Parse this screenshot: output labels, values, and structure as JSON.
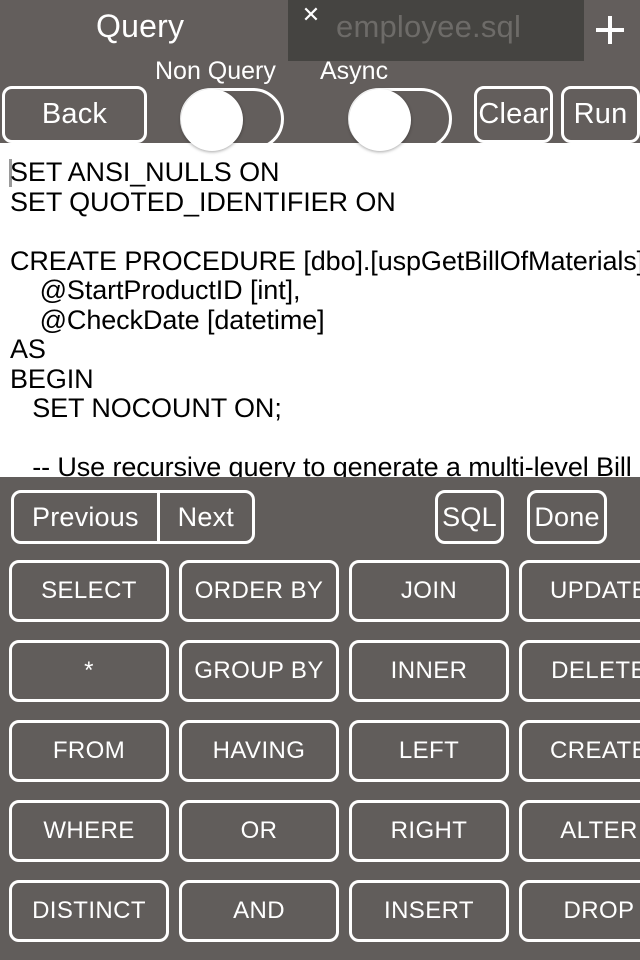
{
  "header": {
    "title": "Query",
    "add_tab_icon": "plus-icon",
    "tab": {
      "label": "employee.sql",
      "close_icon": "close-icon"
    },
    "switches": [
      {
        "label": "Non Query",
        "state": "off"
      },
      {
        "label": "Async",
        "state": "off"
      }
    ],
    "buttons": {
      "back": "Back",
      "clear": "Clear",
      "run": "Run"
    },
    "colors": {
      "bar": "#635E5C",
      "tab": "#454441",
      "tab_text": "#6D6B68",
      "text": "#FFFFFF"
    }
  },
  "editor": {
    "caret_visible": true,
    "lines": [
      "SET ANSI_NULLS ON",
      "SET QUOTED_IDENTIFIER ON",
      "",
      "CREATE PROCEDURE [dbo].[uspGetBillOfMaterials]",
      "    @StartProductID [int],",
      "    @CheckDate [datetime]",
      "AS",
      "BEGIN",
      "   SET NOCOUNT ON;",
      "",
      "   -- Use recursive query to generate a multi-level Bill"
    ]
  },
  "keyboard": {
    "background": "#615D5B",
    "toolbar": {
      "segmented": [
        "Previous",
        "Next"
      ],
      "sql_label": "SQL",
      "done_label": "Done"
    },
    "keys": [
      [
        "SELECT",
        "ORDER BY",
        "JOIN",
        "UPDATE"
      ],
      [
        "*",
        "GROUP BY",
        "INNER",
        "DELETE"
      ],
      [
        "FROM",
        "HAVING",
        "LEFT",
        "CREATE"
      ],
      [
        "WHERE",
        "OR",
        "RIGHT",
        "ALTER"
      ],
      [
        "DISTINCT",
        "AND",
        "INSERT",
        "DROP"
      ]
    ]
  }
}
